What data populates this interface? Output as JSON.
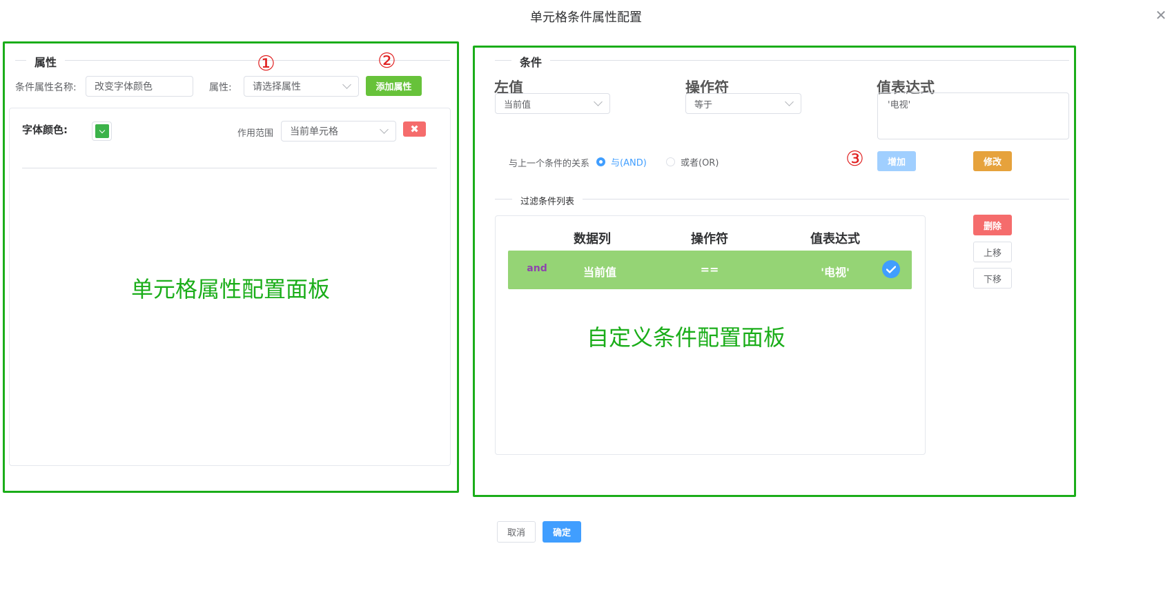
{
  "dialog": {
    "title": "单元格条件属性配置",
    "close_icon": "close-icon"
  },
  "left_panel": {
    "legend": "属性",
    "annotation_1": "①",
    "annotation_2": "②",
    "name_label": "条件属性名称:",
    "name_value": "改变字体颜色",
    "attr_label": "属性:",
    "attr_placeholder": "请选择属性",
    "add_button": "添加属性",
    "font_color_label": "字体颜色:",
    "font_color": "#3cb34a",
    "scope_label": "作用范围",
    "scope_value": "当前单元格",
    "remove_icon": "close-icon",
    "overlay_text": "单元格属性配置面板"
  },
  "right_panel": {
    "legend": "条件",
    "left_value_label": "左值",
    "left_value": "当前值",
    "operator_label": "操作符",
    "operator_value": "等于",
    "expr_label": "值表达式",
    "expr_value": "'电视'",
    "relation_label": "与上一个条件的关系",
    "relation_options": [
      "与(AND)",
      "或者(OR)"
    ],
    "relation_selected": "与(AND)",
    "annotation_3": "③",
    "add_button": "增加",
    "modify_button": "修改",
    "filter_legend": "过滤条件列表",
    "table": {
      "headers": [
        "数据列",
        "操作符",
        "值表达式"
      ],
      "rows": [
        {
          "logic": "and",
          "column": "当前值",
          "operator": "==",
          "expr": "'电视'",
          "checked": true
        }
      ]
    },
    "delete_button": "删除",
    "up_button": "上移",
    "down_button": "下移",
    "overlay_text": "自定义条件配置面板"
  },
  "footer": {
    "cancel_button": "取消",
    "ok_button": "确定"
  },
  "colors": {
    "annotation_green": "#1aad19",
    "row_green": "#95d475",
    "and_purple": "#8e44ad"
  }
}
